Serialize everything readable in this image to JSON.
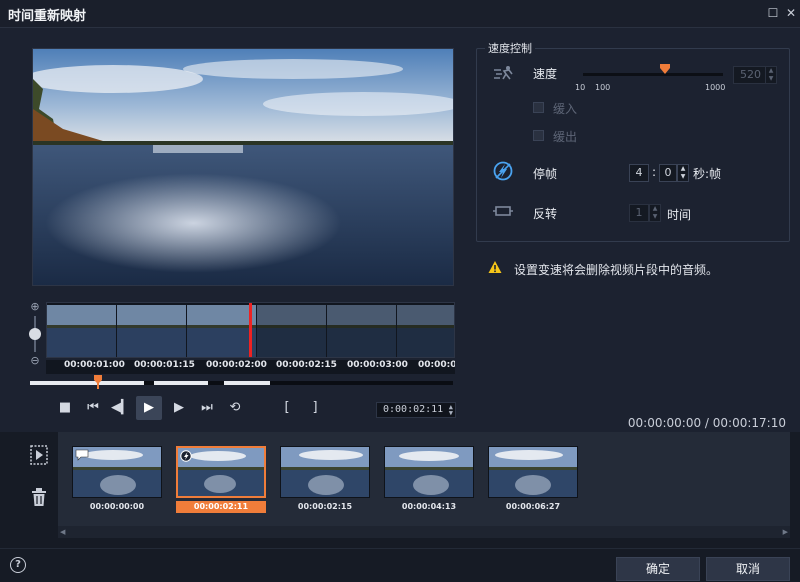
{
  "window": {
    "title": "时间重新映射"
  },
  "preview": {
    "filmstrip_timecodes": [
      "00:00:01:00",
      "00:00:01:15",
      "00:00:02:00",
      "00:00:02:15",
      "00:00:03:00",
      "00:00:0"
    ]
  },
  "transport": {
    "stop_icon": "■",
    "prev_icon": "⏮",
    "step_back_icon": "◀▎",
    "play_icon": "▶",
    "step_fwd_icon": "▶",
    "next_icon": "⏭",
    "loop_icon": "⟲",
    "mark_in": "[",
    "mark_out": "]",
    "timecode": "0:00:02:11"
  },
  "speed_control": {
    "legend": "速度控制",
    "speed_label": "速度",
    "speed_value": "520",
    "slider_ticks": {
      "min": "10",
      "mid": "100",
      "max": "1000"
    },
    "ease_in_label": "缓入",
    "ease_out_label": "缓出",
    "freeze_label": "停帧",
    "freeze_seconds": "4",
    "freeze_frames": "0",
    "freeze_unit": "秒:帧",
    "reverse_label": "反转",
    "reverse_value": "1",
    "reverse_unit": "时间"
  },
  "warning": {
    "text": "设置变速将会删除视频片段中的音频。"
  },
  "total_time": "00:00:00:00 / 00:00:17:10",
  "clips": [
    {
      "time": "00:00:00:00",
      "selected": false,
      "badge": "comment"
    },
    {
      "time": "00:00:02:11",
      "selected": true,
      "badge": "freeze"
    },
    {
      "time": "00:00:02:15",
      "selected": false,
      "badge": ""
    },
    {
      "time": "00:00:04:13",
      "selected": false,
      "badge": ""
    },
    {
      "time": "00:00:06:27",
      "selected": false,
      "badge": ""
    }
  ],
  "footer": {
    "help": "?",
    "ok_label": "确定",
    "cancel_label": "取消"
  },
  "colors": {
    "accent": "#f07d3a",
    "playhead": "#ee2222",
    "bg": "#1c2230"
  }
}
